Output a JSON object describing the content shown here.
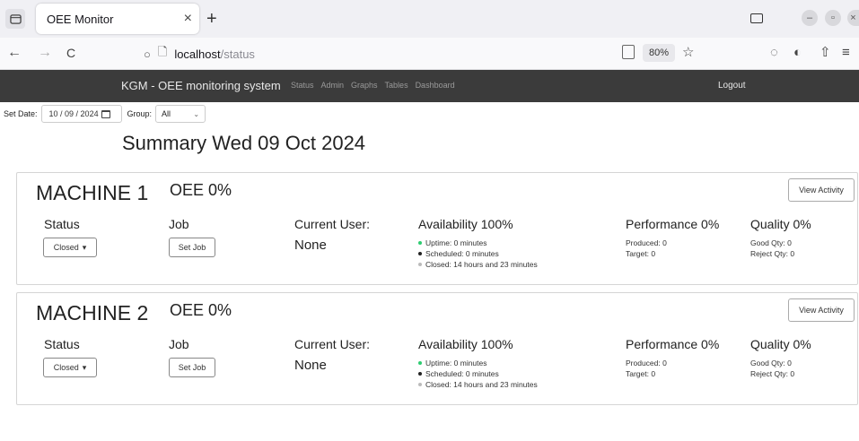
{
  "browser": {
    "tab_title": "OEE Monitor",
    "tab_close": "×",
    "new_tab": "+",
    "back": "←",
    "forward": "→",
    "reload": "C",
    "url_host": "localhost",
    "url_path": "/status",
    "zoom": "80%",
    "bookmark_star": "☆"
  },
  "header": {
    "brand": "KGM - OEE monitoring system",
    "nav": [
      "Status",
      "Admin",
      "Graphs",
      "Tables",
      "Dashboard"
    ],
    "logout": "Logout",
    "bg_color": "#3b3b3b"
  },
  "filters": {
    "date_label": "Set Date:",
    "date_value": "10 / 09 / 2024",
    "group_label": "Group:",
    "group_value": "All"
  },
  "summary_title": "Summary Wed 09 Oct 2024",
  "labels": {
    "status": "Status",
    "job": "Job",
    "current_user": "Current User:",
    "view_activity": "View Activity",
    "set_job": "Set Job"
  },
  "machines": [
    {
      "name": "MACHINE 1",
      "oee": "OEE 0%",
      "status": "Closed",
      "user": "None",
      "availability": "Availability 100%",
      "uptime": "Uptime: 0 minutes",
      "scheduled": "Scheduled: 0 minutes",
      "closed": "Closed: 14 hours and 23 minutes",
      "performance": "Performance 0%",
      "produced": "Produced: 0",
      "target": "Target: 0",
      "quality": "Quality 0%",
      "good_qty": "Good Qty: 0",
      "reject_qty": "Reject Qty: 0"
    },
    {
      "name": "MACHINE 2",
      "oee": "OEE 0%",
      "status": "Closed",
      "user": "None",
      "availability": "Availability 100%",
      "uptime": "Uptime: 0 minutes",
      "scheduled": "Scheduled: 0 minutes",
      "closed": "Closed: 14 hours and 23 minutes",
      "performance": "Performance 0%",
      "produced": "Produced: 0",
      "target": "Target: 0",
      "quality": "Quality 0%",
      "good_qty": "Good Qty: 0",
      "reject_qty": "Reject Qty: 0"
    }
  ],
  "colors": {
    "uptime_dot": "#2ecc71",
    "scheduled_dot": "#222222",
    "closed_dot": "#bbbbbb"
  }
}
